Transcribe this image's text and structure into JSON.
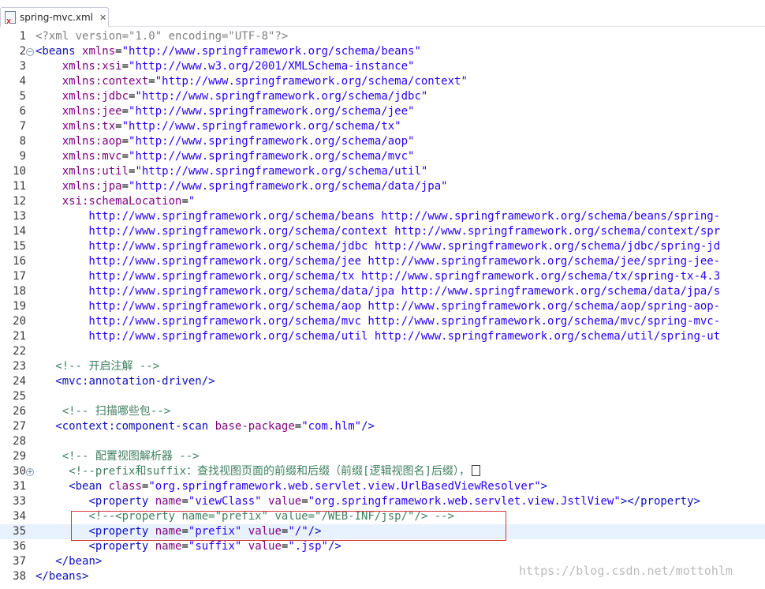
{
  "tab": {
    "filename": "spring-mvc.xml",
    "close_glyph": "✕",
    "icon": "xml-file-icon"
  },
  "lines": [
    {
      "n": "1",
      "tokens": [
        [
          "pi",
          "<?xml version=\"1.0\" encoding=\"UTF-8\"?>"
        ]
      ]
    },
    {
      "n": "2",
      "fold": "⊖",
      "tokens": [
        [
          "tag",
          "<beans"
        ],
        [
          "txt",
          " "
        ],
        [
          "attr",
          "xmlns"
        ],
        [
          "txt",
          "="
        ],
        [
          "val",
          "\"http://www.springframework.org/schema/beans\""
        ]
      ]
    },
    {
      "n": "3",
      "tokens": [
        [
          "txt",
          "    "
        ],
        [
          "attr",
          "xmlns:xsi"
        ],
        [
          "txt",
          "="
        ],
        [
          "val",
          "\"http://www.w3.org/2001/XMLSchema-instance\""
        ]
      ]
    },
    {
      "n": "4",
      "tokens": [
        [
          "txt",
          "    "
        ],
        [
          "attr",
          "xmlns:context"
        ],
        [
          "txt",
          "="
        ],
        [
          "val",
          "\"http://www.springframework.org/schema/context\""
        ]
      ]
    },
    {
      "n": "5",
      "tokens": [
        [
          "txt",
          "    "
        ],
        [
          "attr",
          "xmlns:jdbc"
        ],
        [
          "txt",
          "="
        ],
        [
          "val",
          "\"http://www.springframework.org/schema/jdbc\""
        ]
      ]
    },
    {
      "n": "6",
      "tokens": [
        [
          "txt",
          "    "
        ],
        [
          "attr",
          "xmlns:jee"
        ],
        [
          "txt",
          "="
        ],
        [
          "val",
          "\"http://www.springframework.org/schema/jee\""
        ]
      ]
    },
    {
      "n": "7",
      "tokens": [
        [
          "txt",
          "    "
        ],
        [
          "attr",
          "xmlns:tx"
        ],
        [
          "txt",
          "="
        ],
        [
          "val",
          "\"http://www.springframework.org/schema/tx\""
        ]
      ]
    },
    {
      "n": "8",
      "tokens": [
        [
          "txt",
          "    "
        ],
        [
          "attr",
          "xmlns:aop"
        ],
        [
          "txt",
          "="
        ],
        [
          "val",
          "\"http://www.springframework.org/schema/aop\""
        ]
      ]
    },
    {
      "n": "9",
      "tokens": [
        [
          "txt",
          "    "
        ],
        [
          "attr",
          "xmlns:mvc"
        ],
        [
          "txt",
          "="
        ],
        [
          "val",
          "\"http://www.springframework.org/schema/mvc\""
        ]
      ]
    },
    {
      "n": "10",
      "tokens": [
        [
          "txt",
          "    "
        ],
        [
          "attr",
          "xmlns:util"
        ],
        [
          "txt",
          "="
        ],
        [
          "val",
          "\"http://www.springframework.org/schema/util\""
        ]
      ]
    },
    {
      "n": "11",
      "tokens": [
        [
          "txt",
          "    "
        ],
        [
          "attr",
          "xmlns:jpa"
        ],
        [
          "txt",
          "="
        ],
        [
          "val",
          "\"http://www.springframework.org/schema/data/jpa\""
        ]
      ]
    },
    {
      "n": "12",
      "tokens": [
        [
          "txt",
          "    "
        ],
        [
          "attr",
          "xsi:schemaLocation"
        ],
        [
          "txt",
          "="
        ],
        [
          "val",
          "\""
        ]
      ]
    },
    {
      "n": "13",
      "tokens": [
        [
          "val",
          "        http://www.springframework.org/schema/beans http://www.springframework.org/schema/beans/spring-"
        ]
      ]
    },
    {
      "n": "14",
      "tokens": [
        [
          "val",
          "        http://www.springframework.org/schema/context http://www.springframework.org/schema/context/spr"
        ]
      ]
    },
    {
      "n": "15",
      "tokens": [
        [
          "val",
          "        http://www.springframework.org/schema/jdbc http://www.springframework.org/schema/jdbc/spring-jd"
        ]
      ]
    },
    {
      "n": "16",
      "tokens": [
        [
          "val",
          "        http://www.springframework.org/schema/jee http://www.springframework.org/schema/jee/spring-jee-"
        ]
      ]
    },
    {
      "n": "17",
      "tokens": [
        [
          "val",
          "        http://www.springframework.org/schema/tx http://www.springframework.org/schema/tx/spring-tx-4.3"
        ]
      ]
    },
    {
      "n": "18",
      "tokens": [
        [
          "val",
          "        http://www.springframework.org/schema/data/jpa http://www.springframework.org/schema/data/jpa/s"
        ]
      ]
    },
    {
      "n": "19",
      "tokens": [
        [
          "val",
          "        http://www.springframework.org/schema/aop http://www.springframework.org/schema/aop/spring-aop-"
        ]
      ]
    },
    {
      "n": "20",
      "tokens": [
        [
          "val",
          "        http://www.springframework.org/schema/mvc http://www.springframework.org/schema/mvc/spring-mvc-"
        ]
      ]
    },
    {
      "n": "21",
      "tokens": [
        [
          "val",
          "        http://www.springframework.org/schema/util http://www.springframework.org/schema/util/spring-ut"
        ]
      ]
    },
    {
      "n": "22",
      "tokens": []
    },
    {
      "n": "23",
      "tokens": [
        [
          "txt",
          "   "
        ],
        [
          "cm",
          "<!-- 开启注解 -->"
        ]
      ]
    },
    {
      "n": "24",
      "tokens": [
        [
          "txt",
          "   "
        ],
        [
          "tag",
          "<mvc:annotation-driven/>"
        ]
      ]
    },
    {
      "n": "25",
      "tokens": []
    },
    {
      "n": "26",
      "tokens": [
        [
          "txt",
          "    "
        ],
        [
          "cm",
          "<!-- 扫描哪些包-->"
        ]
      ]
    },
    {
      "n": "27",
      "tokens": [
        [
          "txt",
          "   "
        ],
        [
          "tag",
          "<context:component-scan"
        ],
        [
          "txt",
          " "
        ],
        [
          "attr",
          "base-package"
        ],
        [
          "txt",
          "="
        ],
        [
          "val",
          "\"com.hlm\""
        ],
        [
          "tag",
          "/>"
        ]
      ]
    },
    {
      "n": "28",
      "tokens": []
    },
    {
      "n": "29",
      "tokens": [
        [
          "txt",
          "    "
        ],
        [
          "cm",
          "<!-- 配置视图解析器 -->"
        ]
      ]
    },
    {
      "n": "30",
      "fold": "⊕",
      "tokens": [
        [
          "txt",
          "     "
        ],
        [
          "cm",
          "<!--prefix和suffix：查找视图页面的前缀和后缀（前缀[逻辑视图名]后缀），"
        ]
      ],
      "collapsed": true
    },
    {
      "n": "31",
      "tokens": [
        [
          "txt",
          "     "
        ],
        [
          "tag",
          "<bean"
        ],
        [
          "txt",
          " "
        ],
        [
          "attr",
          "class"
        ],
        [
          "txt",
          "="
        ],
        [
          "val",
          "\"org.springframework.web.servlet.view.UrlBasedViewResolver\""
        ],
        [
          "tag",
          ">"
        ]
      ]
    },
    {
      "n": "33",
      "tokens": [
        [
          "txt",
          "        "
        ],
        [
          "tag",
          "<property"
        ],
        [
          "txt",
          " "
        ],
        [
          "attr",
          "name"
        ],
        [
          "txt",
          "="
        ],
        [
          "val",
          "\"viewClass\""
        ],
        [
          "txt",
          " "
        ],
        [
          "attr",
          "value"
        ],
        [
          "txt",
          "="
        ],
        [
          "val",
          "\"org.springframework.web.servlet.view.JstlView\""
        ],
        [
          "tag",
          "></property>"
        ]
      ]
    },
    {
      "n": "34",
      "tokens": [
        [
          "txt",
          "        "
        ],
        [
          "cm",
          "<!--<property name=\"prefix\" value=\"/WEB-INF/jsp/\"/> -->"
        ]
      ]
    },
    {
      "n": "35",
      "current": true,
      "tokens": [
        [
          "txt",
          "        "
        ],
        [
          "tag",
          "<property"
        ],
        [
          "txt",
          " "
        ],
        [
          "attr",
          "name"
        ],
        [
          "txt",
          "="
        ],
        [
          "val",
          "\"prefix\""
        ],
        [
          "txt",
          " "
        ],
        [
          "attr",
          "value"
        ],
        [
          "txt",
          "="
        ],
        [
          "val",
          "\"/\""
        ],
        [
          "tag",
          "/>"
        ]
      ]
    },
    {
      "n": "36",
      "tokens": [
        [
          "txt",
          "        "
        ],
        [
          "tag",
          "<property"
        ],
        [
          "txt",
          " "
        ],
        [
          "attr",
          "name"
        ],
        [
          "txt",
          "="
        ],
        [
          "val",
          "\"suffix\""
        ],
        [
          "txt",
          " "
        ],
        [
          "attr",
          "value"
        ],
        [
          "txt",
          "="
        ],
        [
          "val",
          "\".jsp\""
        ],
        [
          "tag",
          "/>"
        ]
      ]
    },
    {
      "n": "37",
      "tokens": [
        [
          "txt",
          "   "
        ],
        [
          "tag",
          "</bean>"
        ]
      ]
    },
    {
      "n": "38",
      "tokens": [
        [
          "tag",
          "</beans>"
        ]
      ]
    }
  ],
  "watermark": "https://blog.csdn.net/mottohlm",
  "colors": {
    "tag": "#0e0ebd",
    "attr": "#7f007f",
    "value": "#2a00ff",
    "comment": "#3f7f5f",
    "highlight_border": "#d6333a",
    "current_line": "#e8f2fe"
  }
}
